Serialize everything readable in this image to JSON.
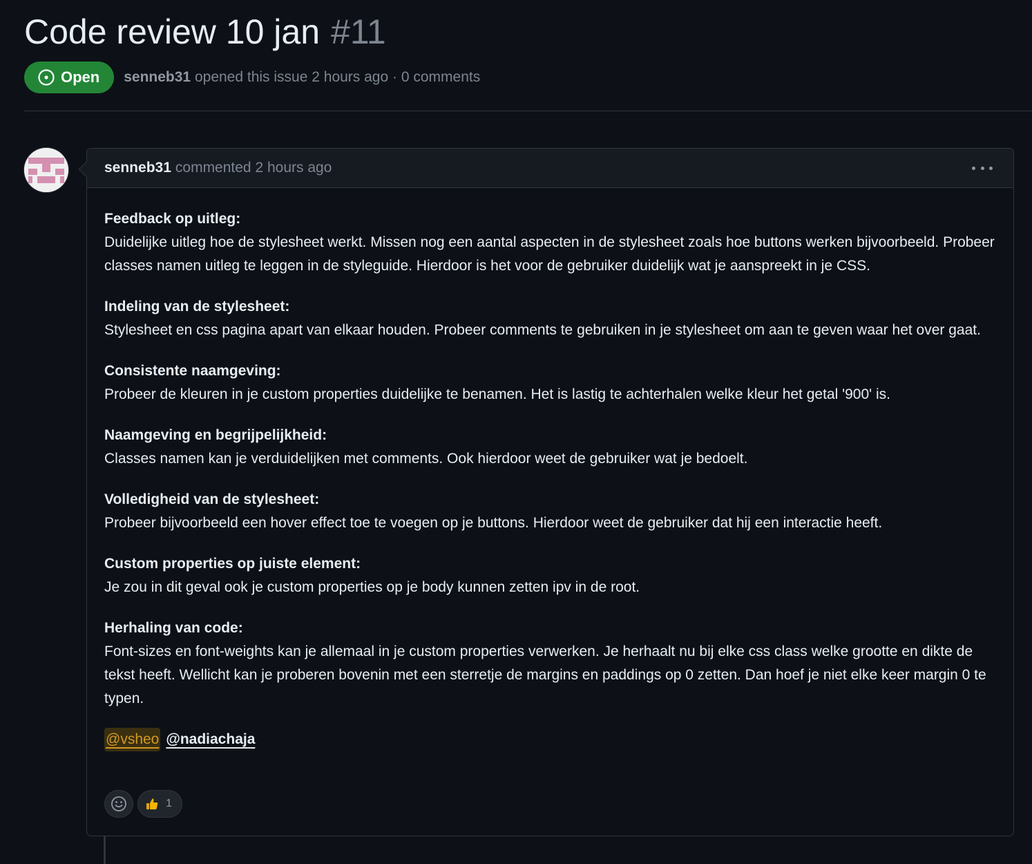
{
  "issue": {
    "title": "Code review 10 jan",
    "number": "#11",
    "state": "Open",
    "author": "senneb31",
    "meta": "opened this issue 2 hours ago · 0 comments"
  },
  "comment": {
    "author": "senneb31",
    "time": "commented 2 hours ago",
    "sections": [
      {
        "heading": "Feedback op uitleg:",
        "text": "Duidelijke uitleg hoe de stylesheet werkt. Missen nog een aantal aspecten in de stylesheet zoals hoe buttons werken bijvoorbeeld. Probeer classes namen uitleg te leggen in de styleguide. Hierdoor is het voor de gebruiker duidelijk wat je aanspreekt in je CSS."
      },
      {
        "heading": "Indeling van de stylesheet:",
        "text": "Stylesheet en css pagina apart van elkaar houden. Probeer comments te gebruiken in je stylesheet om aan te geven waar het over gaat."
      },
      {
        "heading": "Consistente naamgeving:",
        "text": "Probeer de kleuren in je custom properties duidelijke te benamen. Het is lastig te achterhalen welke kleur het getal '900' is."
      },
      {
        "heading": "Naamgeving en begrijpelijkheid:",
        "text": "Classes namen kan je verduidelijken met comments. Ook hierdoor weet de gebruiker wat je bedoelt."
      },
      {
        "heading": "Volledigheid van de stylesheet:",
        "text": "Probeer bijvoorbeeld een hover effect toe te voegen op je buttons. Hierdoor weet de gebruiker dat hij een interactie heeft."
      },
      {
        "heading": "Custom properties op juiste element:",
        "text": "Je zou in dit geval ook je custom properties op je body kunnen zetten ipv in de root."
      },
      {
        "heading": "Herhaling van code:",
        "text": "Font-sizes en font-weights kan je allemaal in je custom properties verwerken. Je herhaalt nu bij elke css class welke grootte en dikte de tekst heeft. Wellicht kan je proberen bovenin met een sterretje de margins en paddings op 0 zetten. Dan hoef je niet elke keer margin 0 te typen."
      }
    ],
    "mentions": [
      "@vsheo",
      "@nadiachaja"
    ],
    "reactions": {
      "thumbs_up_count": "1"
    }
  },
  "colors": {
    "background": "#0d1117",
    "open_badge": "#238636",
    "border": "#30363d",
    "muted_text": "#7d8590",
    "mention_highlight": "#d29922"
  },
  "icons": {
    "state": "issue-opened-icon",
    "menu": "kebab-horizontal-icon",
    "emoji": "smiley-icon",
    "reaction": "thumbs-up-icon"
  }
}
